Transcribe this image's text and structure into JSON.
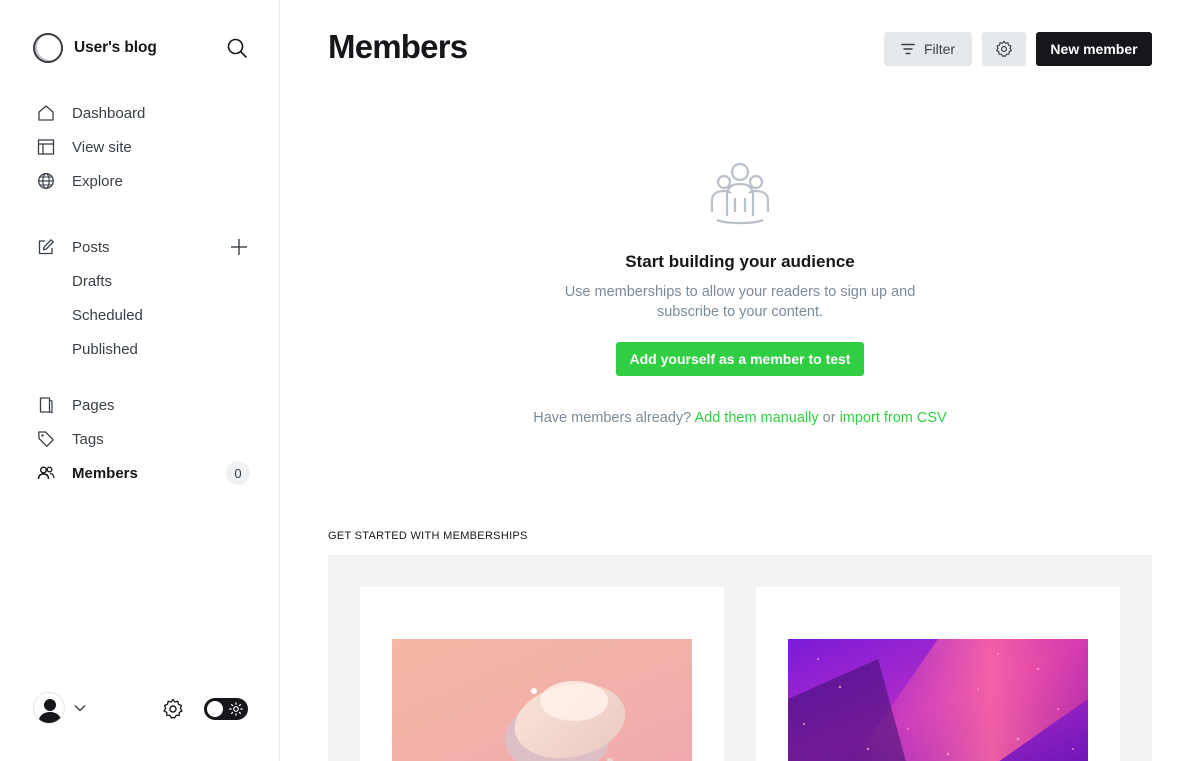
{
  "sidebar": {
    "brand_name": "User's blog",
    "nav": [
      {
        "label": "Dashboard",
        "icon": "home-icon"
      },
      {
        "label": "View site",
        "icon": "layout-icon"
      },
      {
        "label": "Explore",
        "icon": "globe-icon"
      }
    ],
    "posts": {
      "label": "Posts",
      "icon": "edit-icon",
      "sub": [
        "Drafts",
        "Scheduled",
        "Published"
      ]
    },
    "nav2": [
      {
        "label": "Pages",
        "icon": "page-icon"
      },
      {
        "label": "Tags",
        "icon": "tag-icon"
      },
      {
        "label": "Members",
        "icon": "members-icon",
        "count": "0",
        "active": true
      }
    ]
  },
  "header": {
    "title": "Members",
    "filter_label": "Filter",
    "new_member_label": "New member"
  },
  "empty_state": {
    "title": "Start building your audience",
    "text": "Use memberships to allow your readers to sign up and subscribe to your content.",
    "cta_label": "Add yourself as a member to test",
    "have_members_prefix": "Have members already?",
    "add_manually_link": "Add them manually",
    "or_text": "or",
    "import_link": "import from CSV"
  },
  "get_started": {
    "label": "GET STARTED WITH MEMBERSHIPS"
  },
  "colors": {
    "accent_green": "#30cf43",
    "dark": "#15171a"
  }
}
